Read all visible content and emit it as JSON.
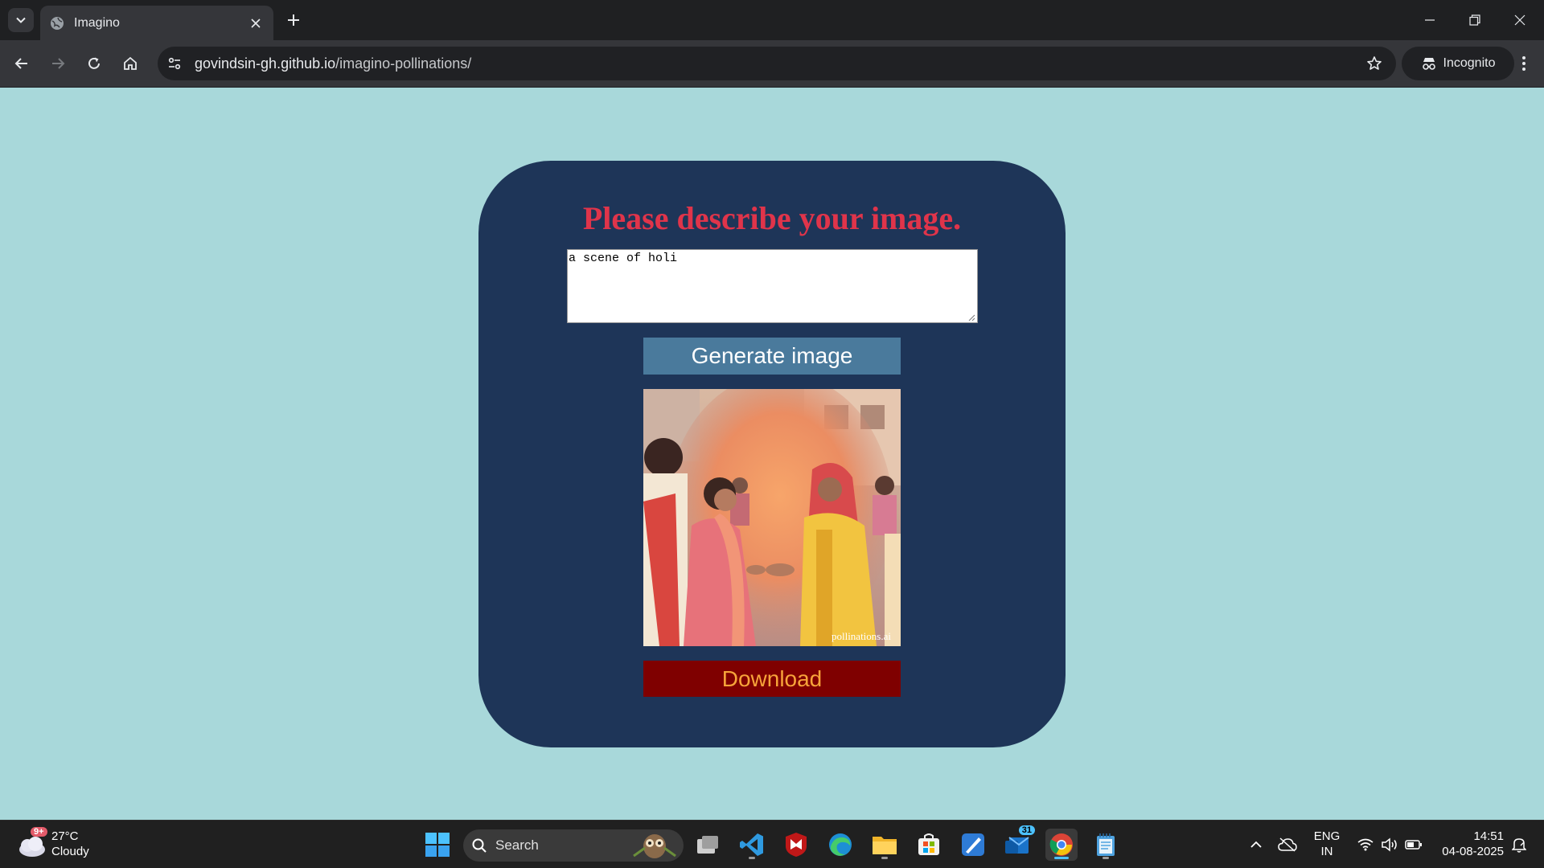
{
  "browser": {
    "tab_title": "Imagino",
    "url_host": "govindsin-gh.github.io",
    "url_path": "/imagino-pollinations/",
    "incognito_label": "Incognito"
  },
  "page": {
    "heading": "Please describe your image.",
    "prompt_value": "a scene of holi",
    "generate_label": "Generate image",
    "image_watermark": "pollinations.ai",
    "download_label": "Download",
    "colors": {
      "background": "#a8d8da",
      "card": "#1e3558",
      "heading": "#e0344a",
      "generate_button": "#4a7a9c",
      "download_button": "#7f0000",
      "download_text": "#f7a43a"
    }
  },
  "taskbar": {
    "weather_temp": "27°C",
    "weather_condition": "Cloudy",
    "weather_badge": "9+",
    "search_label": "Search",
    "mail_badge": "31",
    "lang_line1": "ENG",
    "lang_line2": "IN",
    "time": "14:51",
    "date": "04-08-2025"
  }
}
